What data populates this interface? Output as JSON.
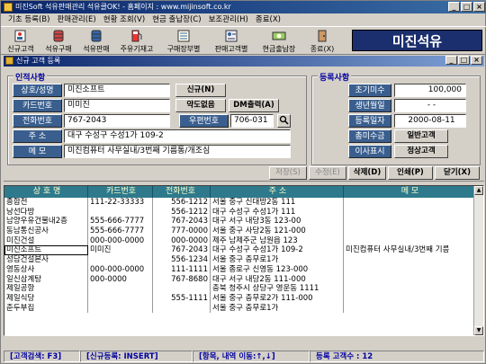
{
  "window": {
    "title": "미진Soft 석유판매관리 석유클OK! - 홈페이지 : www.mijinsoft.co.kr",
    "btn_min": "_",
    "btn_max": "□",
    "btn_close": "×"
  },
  "menu": [
    "기초 등록(B)",
    "판매관리(E)",
    "현황 조회(V)",
    "현금 출납장(C)",
    "보조관리(H)",
    "종료(X)"
  ],
  "toolbar": {
    "items": [
      "신규고객",
      "석유구매",
      "석유판매",
      "주유기재고",
      "구매장부별",
      "판매고객별",
      "현금출납장",
      "종료(X)"
    ],
    "brand": "미진석유"
  },
  "subwindow": {
    "title": "신규 고객 등록",
    "btn_min": "_",
    "btn_max": "□",
    "btn_close": "×"
  },
  "personal": {
    "group_title": "인적사항",
    "labels": {
      "name": "상호/성명",
      "card": "카드번호",
      "phone": "전화번호",
      "address": "주    소",
      "memo": "메    모",
      "zip": "우편번호"
    },
    "values": {
      "name": "미진소프트",
      "card": "미미진",
      "phone": "767-2043",
      "zip": "706-031",
      "address": "대구 수성구 수성1가 109-2",
      "memo": "미진컴퓨터 사무실내/3번째 기름통/개조심"
    },
    "buttons": {
      "new": "신규(N)",
      "abbrev": "약도없음",
      "dm_print": "DM출력(A)"
    }
  },
  "registration": {
    "group_title": "등록사항",
    "labels": {
      "initial_unpaid": "초기미수",
      "birthday": "생년월일",
      "reg_date": "등록일자",
      "total_unpaid": "총미수금",
      "display": "이사표시"
    },
    "values": {
      "initial_unpaid": "100,000",
      "birthday": "- -",
      "reg_date": "2000-08-11"
    },
    "buttons": {
      "normal": "일반고객",
      "regular": "정상고객"
    }
  },
  "actions": {
    "save": "저장(S)",
    "edit": "수정(E)",
    "delete": "삭제(D)",
    "print": "인쇄(P)",
    "close": "닫기(X)"
  },
  "grid": {
    "headers": [
      "상 호 명",
      "카드번호",
      "전화번호",
      "주      소",
      "메      모"
    ],
    "rows": [
      [
        "종합전",
        "111-22-33333",
        "556-1212",
        "서울 중구 신대방2동 111",
        ""
      ],
      [
        "낭선다방",
        "",
        "556-1212",
        "대구 수성구 수성1가 111",
        ""
      ],
      [
        "남양우유건물내2층",
        "555-666-7777",
        "767-2043",
        "대구 서구 내당3동 123-00",
        ""
      ],
      [
        "동남통신공사",
        "555-666-7777",
        "777-0000",
        "서울 중구 사당2동 121-000",
        ""
      ],
      [
        "미진건설",
        "000-000-0000",
        "000-0000",
        "제주 남제주군 남원읍 123",
        ""
      ],
      [
        "미진소프트",
        "미미진",
        "767-2043",
        "대구 수성구 수성1가 109-2",
        "미진컴퓨터 사무실내/3번째 기름"
      ],
      [
        "성담건설본사",
        "",
        "556-1234",
        "서울 중구 충무로1가",
        ""
      ],
      [
        "영동상사",
        "000-000-0000",
        "111-1111",
        "서울 종로구 신영동 123-000",
        ""
      ],
      [
        "일신삼계탕",
        "000-0000",
        "767-8680",
        "대구 서구 내당2동 111-000",
        ""
      ],
      [
        "제일공항",
        "",
        "",
        "충북 청주시 상당구 영운동 1111",
        ""
      ],
      [
        "제일식당",
        "",
        "555-1111",
        "서울 중구 충무로2가 111-000",
        ""
      ],
      [
        "춘두부집",
        "",
        "",
        "서울 중구 충무로1가",
        ""
      ]
    ]
  },
  "status": {
    "search": "[고객검색: F3]",
    "new": "[신규등록: INSERT]",
    "move": "[항목, 내역 이동:↑,↓]",
    "count": "등록 고객수 : 12"
  }
}
